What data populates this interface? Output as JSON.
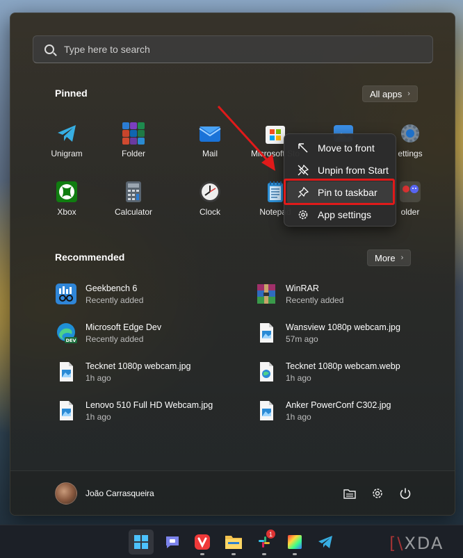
{
  "search": {
    "placeholder": "Type here to search"
  },
  "pinned": {
    "title": "Pinned",
    "all_apps_label": "All apps",
    "apps": [
      {
        "label": "Unigram",
        "icon": "telegram-icon"
      },
      {
        "label": "Folder",
        "icon": "office-folder-icon"
      },
      {
        "label": "Mail",
        "icon": "mail-icon"
      },
      {
        "label": "Microsoft Sto",
        "icon": "store-icon"
      },
      {
        "label": "",
        "icon": "photos-icon"
      },
      {
        "label": "ettings",
        "icon": "settings-icon"
      },
      {
        "label": "Xbox",
        "icon": "xbox-icon"
      },
      {
        "label": "Calculator",
        "icon": "calculator-icon"
      },
      {
        "label": "Clock",
        "icon": "clock-icon"
      },
      {
        "label": "Notepad",
        "icon": "notepad-icon"
      },
      {
        "label": "",
        "icon": "blank"
      },
      {
        "label": "older",
        "icon": "discord-folder-icon"
      }
    ]
  },
  "context_menu": {
    "items": [
      {
        "label": "Move to front",
        "icon": "move-to-front-icon"
      },
      {
        "label": "Unpin from Start",
        "icon": "unpin-icon"
      },
      {
        "label": "Pin to taskbar",
        "icon": "pin-icon"
      },
      {
        "label": "App settings",
        "icon": "gear-icon"
      }
    ]
  },
  "recommended": {
    "title": "Recommended",
    "more_label": "More",
    "items": [
      {
        "name": "Geekbench 6",
        "sub": "Recently added",
        "icon": "geekbench-icon"
      },
      {
        "name": "WinRAR",
        "sub": "Recently added",
        "icon": "winrar-icon"
      },
      {
        "name": "Microsoft Edge Dev",
        "sub": "Recently added",
        "icon": "edge-dev-icon"
      },
      {
        "name": "Wansview 1080p webcam.jpg",
        "sub": "57m ago",
        "icon": "image-file-icon"
      },
      {
        "name": "Tecknet 1080p webcam.jpg",
        "sub": "1h ago",
        "icon": "image-file-icon"
      },
      {
        "name": "Tecknet 1080p webcam.webp",
        "sub": "1h ago",
        "icon": "webp-file-icon"
      },
      {
        "name": "Lenovo 510 Full HD Webcam.jpg",
        "sub": "1h ago",
        "icon": "image-file-icon"
      },
      {
        "name": "Anker PowerConf C302.jpg",
        "sub": "1h ago",
        "icon": "image-file-icon"
      }
    ]
  },
  "user": {
    "name": "João Carrasqueira"
  },
  "taskbar": {
    "slack_badge": "1"
  },
  "watermark": "XDA",
  "colors": {
    "highlight_box": "#e01a1a",
    "arrow": "#e01a1a"
  }
}
